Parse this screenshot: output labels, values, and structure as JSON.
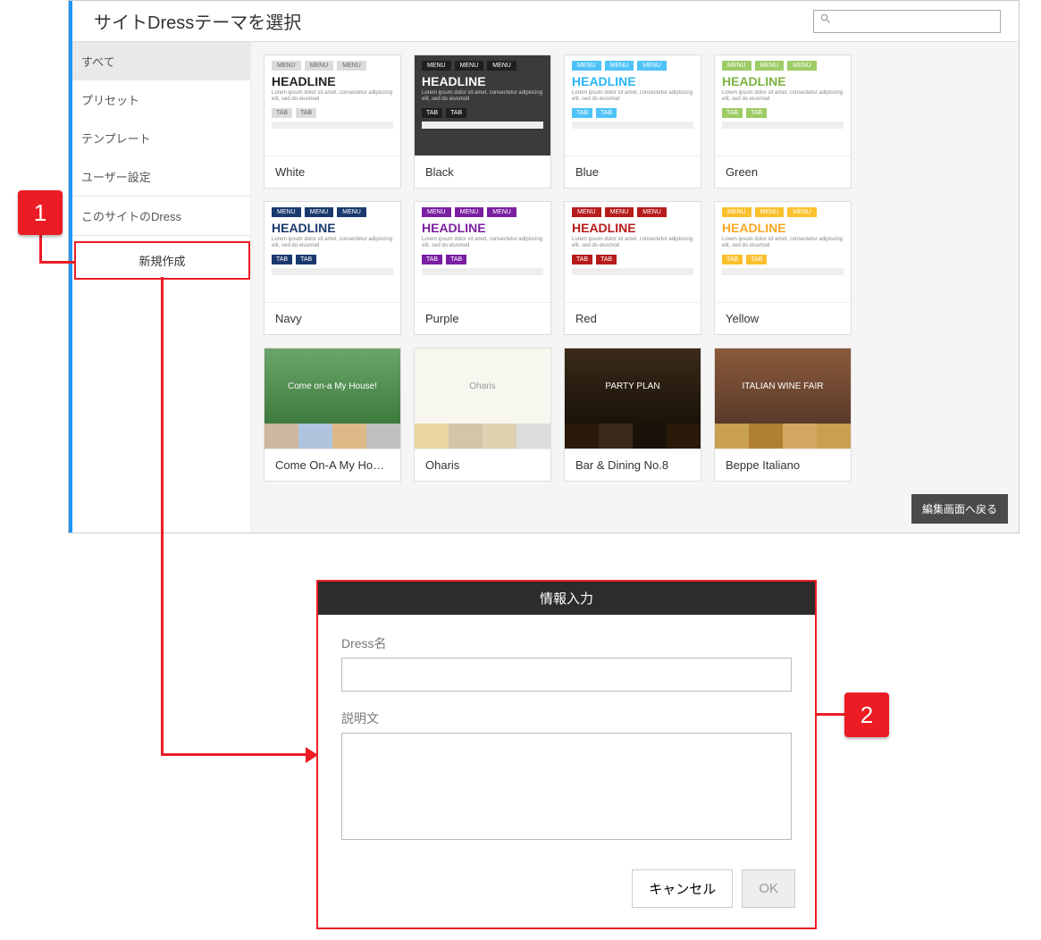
{
  "header": {
    "title": "サイトDressテーマを選択"
  },
  "sidebar": {
    "items": [
      {
        "label": "すべて",
        "active": true
      },
      {
        "label": "プリセット"
      },
      {
        "label": "テンプレート"
      },
      {
        "label": "ユーザー設定"
      }
    ],
    "site_dress": "このサイトのDress",
    "create_new": "新規作成"
  },
  "preview": {
    "menu": "MENU",
    "headline": "HEADLINE",
    "lorem": "Lorem ipsum dolor sit amet, consectetur adipiscing elit, sed do eiusmod",
    "tab": "TAB"
  },
  "themes_row1": [
    {
      "label": "White",
      "bg": "#ffffff",
      "menu": "#dcdcdc",
      "menutext": "#666",
      "head": "#222",
      "tab": "#dcdcdc",
      "tabtext": "#666"
    },
    {
      "label": "Black",
      "bg": "#3b3b3b",
      "menu": "#1f1f1f",
      "menutext": "#fff",
      "head": "#fff",
      "tab": "#1f1f1f",
      "tabtext": "#fff",
      "lorem": "#ccc"
    },
    {
      "label": "Blue",
      "bg": "#ffffff",
      "menu": "#4fc3f7",
      "menutext": "#fff",
      "head": "#29b6f6",
      "tab": "#4fc3f7",
      "tabtext": "#fff"
    },
    {
      "label": "Green",
      "bg": "#ffffff",
      "menu": "#9ccc65",
      "menutext": "#fff",
      "head": "#7cb342",
      "tab": "#9ccc65",
      "tabtext": "#fff"
    }
  ],
  "themes_row2": [
    {
      "label": "Navy",
      "bg": "#ffffff",
      "menu": "#1a3a6e",
      "menutext": "#fff",
      "head": "#1a3a6e",
      "tab": "#1a3a6e",
      "tabtext": "#fff"
    },
    {
      "label": "Purple",
      "bg": "#ffffff",
      "menu": "#7b1fa2",
      "menutext": "#fff",
      "head": "#7b1fa2",
      "tab": "#7b1fa2",
      "tabtext": "#fff"
    },
    {
      "label": "Red",
      "bg": "#ffffff",
      "menu": "#b71c1c",
      "menutext": "#fff",
      "head": "#b71c1c",
      "tab": "#b71c1c",
      "tabtext": "#fff"
    },
    {
      "label": "Yellow",
      "bg": "#ffffff",
      "menu": "#fbc02d",
      "menutext": "#fff",
      "head": "#f9a825",
      "tab": "#fbc02d",
      "tabtext": "#fff"
    }
  ],
  "themes_row3": [
    {
      "label": "Come On-A My Ho…",
      "heroText": "Come on-a My House!",
      "heroBg": "linear-gradient(#6aa56a,#3e7a3e)",
      "thumbs": [
        "#cdb79e",
        "#b0c4de",
        "#deb887",
        "#c0c0c0"
      ]
    },
    {
      "label": "Oharis",
      "heroText": "Oharis",
      "heroBg": "#f7f7f0",
      "heroColor": "#999",
      "thumbs": [
        "#e8d5a0",
        "#d4c4a8",
        "#e0d0b0",
        "#ddd"
      ]
    },
    {
      "label": "Bar & Dining No.8",
      "heroText": "PARTY PLAN",
      "heroBg": "linear-gradient(#3a2a1a,#1a1208)",
      "thumbs": [
        "#2a1a0a",
        "#3a2a1a",
        "#1a1208",
        "#2a1a0a"
      ]
    },
    {
      "label": "Beppe Italiano",
      "heroText": "ITALIAN WINE FAIR",
      "heroBg": "linear-gradient(#8a5a3a,#5a3a2a)",
      "thumbs": [
        "#c9a050",
        "#b08030",
        "#d4a860",
        "#c9a050"
      ]
    }
  ],
  "footer": {
    "back": "編集画面へ戻る"
  },
  "dialog": {
    "title": "情報入力",
    "name_label": "Dress名",
    "desc_label": "説明文",
    "cancel": "キャンセル",
    "ok": "OK"
  },
  "callouts": {
    "one": "1",
    "two": "2"
  }
}
